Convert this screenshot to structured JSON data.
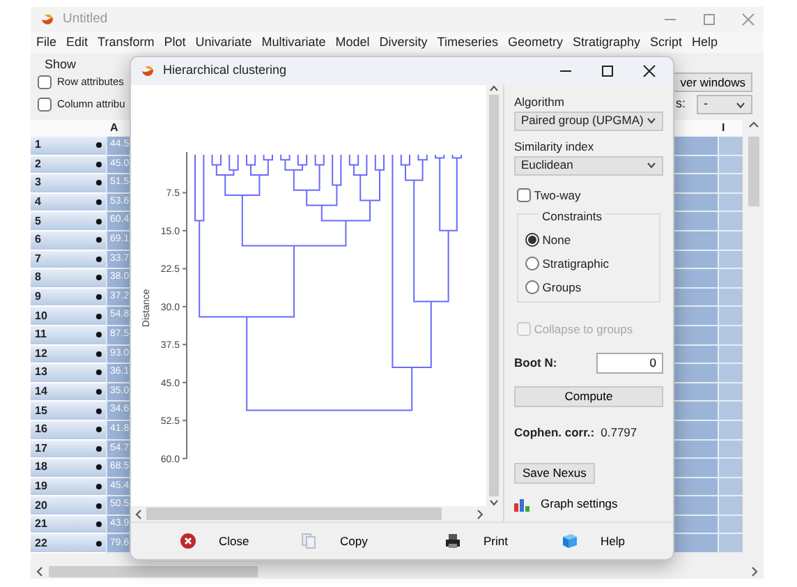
{
  "main_window": {
    "title": "Untitled",
    "menu": [
      "File",
      "Edit",
      "Transform",
      "Plot",
      "Univariate",
      "Multivariate",
      "Model",
      "Diversity",
      "Timeseries",
      "Geometry",
      "Stratigraphy",
      "Script",
      "Help"
    ],
    "group_label": "Show",
    "options": [
      {
        "label": "Row attributes",
        "checked": false
      },
      {
        "label": "Column attribu",
        "checked": false
      }
    ],
    "button_partial": "ver windows",
    "field_label_partial": "s:",
    "dropdown_value": "-",
    "grid": {
      "columns": [
        "A",
        "I"
      ],
      "rows": [
        {
          "label": "1",
          "a": "44.5"
        },
        {
          "label": "2",
          "a": "45.0"
        },
        {
          "label": "3",
          "a": "51.5"
        },
        {
          "label": "4",
          "a": "53.6"
        },
        {
          "label": "5",
          "a": "60.4"
        },
        {
          "label": "6",
          "a": "69.1"
        },
        {
          "label": "7",
          "a": "33.7"
        },
        {
          "label": "8",
          "a": "38.0"
        },
        {
          "label": "9",
          "a": "37.2"
        },
        {
          "label": "10",
          "a": "54.8"
        },
        {
          "label": "11",
          "a": "87.5"
        },
        {
          "label": "12",
          "a": "93.0"
        },
        {
          "label": "13",
          "a": "36.1"
        },
        {
          "label": "14",
          "a": "35.0"
        },
        {
          "label": "15",
          "a": "34.6"
        },
        {
          "label": "16",
          "a": "41.8"
        },
        {
          "label": "17",
          "a": "54.7"
        },
        {
          "label": "18",
          "a": "68.5"
        },
        {
          "label": "19",
          "a": "45.4"
        },
        {
          "label": "20",
          "a": "50.5"
        },
        {
          "label": "21",
          "a": "43.9"
        },
        {
          "label": "22",
          "a": "79.6"
        }
      ]
    }
  },
  "dialog": {
    "title": "Hierarchical clustering",
    "plot": {
      "axis_label": "Distance",
      "ticks": [
        "7.5",
        "15.0",
        "22.5",
        "30.0",
        "37.5",
        "45.0",
        "52.5",
        "60.0"
      ]
    },
    "panel": {
      "algorithm": {
        "label": "Algorithm",
        "value": "Paired group (UPGMA)"
      },
      "similarity": {
        "label": "Similarity index",
        "value": "Euclidean"
      },
      "two_way": {
        "label": "Two-way",
        "checked": false
      },
      "constraints": {
        "title": "Constraints",
        "options": [
          {
            "label": "None",
            "selected": true
          },
          {
            "label": "Stratigraphic",
            "selected": false
          },
          {
            "label": "Groups",
            "selected": false
          }
        ]
      },
      "collapse": {
        "label": "Collapse to groups",
        "checked": false,
        "disabled": true
      },
      "boot": {
        "label": "Boot N:",
        "value": "0"
      },
      "compute": "Compute",
      "cophen": {
        "label": "Cophen. corr.:",
        "value": "0.7797"
      },
      "save_nexus": "Save Nexus",
      "graph_settings": "Graph settings"
    },
    "footer": [
      {
        "kind": "close",
        "label": "Close"
      },
      {
        "kind": "copy",
        "label": "Copy"
      },
      {
        "kind": "print",
        "label": "Print"
      },
      {
        "kind": "help",
        "label": "Help"
      }
    ]
  }
}
